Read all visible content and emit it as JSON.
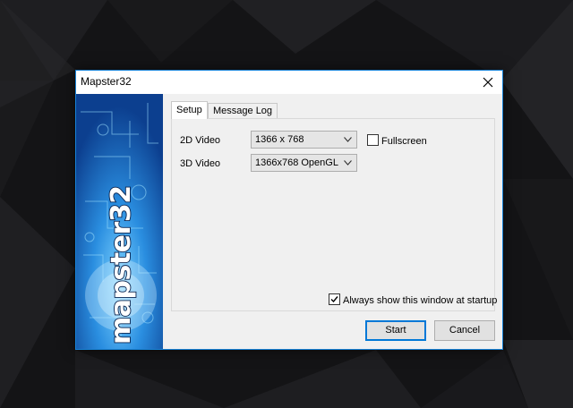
{
  "window": {
    "title": "Mapster32"
  },
  "banner": {
    "logo_text": "mapster32"
  },
  "tabs": [
    {
      "label": "Setup",
      "active": true
    },
    {
      "label": "Message Log",
      "active": false
    }
  ],
  "setup": {
    "video2d_label": "2D Video",
    "video2d_value": "1366 x 768",
    "video3d_label": "3D Video",
    "video3d_value": "1366x768 OpenGL",
    "fullscreen_label": "Fullscreen",
    "fullscreen_checked": false,
    "always_show_label": "Always show this window at startup",
    "always_show_checked": true
  },
  "buttons": {
    "start": "Start",
    "cancel": "Cancel"
  },
  "icons": {
    "close": "close-icon",
    "dropdown": "chevron-down-icon",
    "check": "checkmark-icon"
  },
  "colors": {
    "accent": "#0078d7",
    "window_border": "#1883d7",
    "banner_blue": "#1a5fb5",
    "desktop": "#141416"
  }
}
